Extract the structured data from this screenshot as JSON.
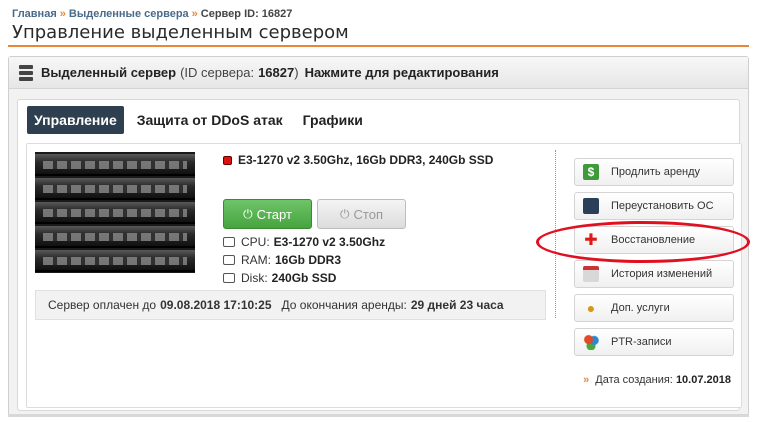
{
  "breadcrumb": {
    "home": "Главная",
    "section": "Выделенные сервера",
    "current": "Сервер ID: 16827",
    "separator": "»"
  },
  "page_title": "Управление выделенным сервером",
  "panel": {
    "title": "Выделенный сервер",
    "id_prefix": "(ID сервера:",
    "id_value": "16827",
    "id_suffix": ")",
    "edit_label": "Нажмите для редактирования"
  },
  "tabs": [
    {
      "label": "Управление",
      "active": true
    },
    {
      "label": "Защита от DDoS атак",
      "active": false
    },
    {
      "label": "Графики",
      "active": false
    }
  ],
  "server": {
    "status_color": "#dd1111",
    "summary": "E3-1270 v2 3.50Ghz, 16Gb DDR3, 240Gb SSD",
    "start_label": "Старт",
    "stop_label": "Стоп",
    "specs": [
      {
        "icon": "cpu-icon",
        "label": "CPU:",
        "value": "E3-1270 v2 3.50Ghz"
      },
      {
        "icon": "ram-icon",
        "label": "RAM:",
        "value": "16Gb DDR3"
      },
      {
        "icon": "disk-icon",
        "label": "Disk:",
        "value": "240Gb SSD"
      }
    ]
  },
  "billing": {
    "paid_until_label": "Сервер оплачен до",
    "paid_until_value": "09.08.2018 17:10:25",
    "remaining_label": "До окончания аренды:",
    "remaining_value": "29 дней 23 часа"
  },
  "actions": [
    {
      "icon": "money-icon",
      "label": "Продлить аренду"
    },
    {
      "icon": "server-stack-icon",
      "label": "Переустановить ОС"
    },
    {
      "icon": "red-cross-icon",
      "label": "Восстановление"
    },
    {
      "icon": "calendar-icon",
      "label": "История изменений"
    },
    {
      "icon": "bag-icon",
      "label": "Доп. услуги"
    },
    {
      "icon": "network-icon",
      "label": "PTR-записи"
    }
  ],
  "created": {
    "arrow": "»",
    "label": "Дата создания:",
    "value": "10.07.2018"
  },
  "colors": {
    "accent_orange": "#e8873a",
    "tab_active": "#2e3f4f",
    "start_green": "#4fae48",
    "highlight_red": "#e01020"
  }
}
